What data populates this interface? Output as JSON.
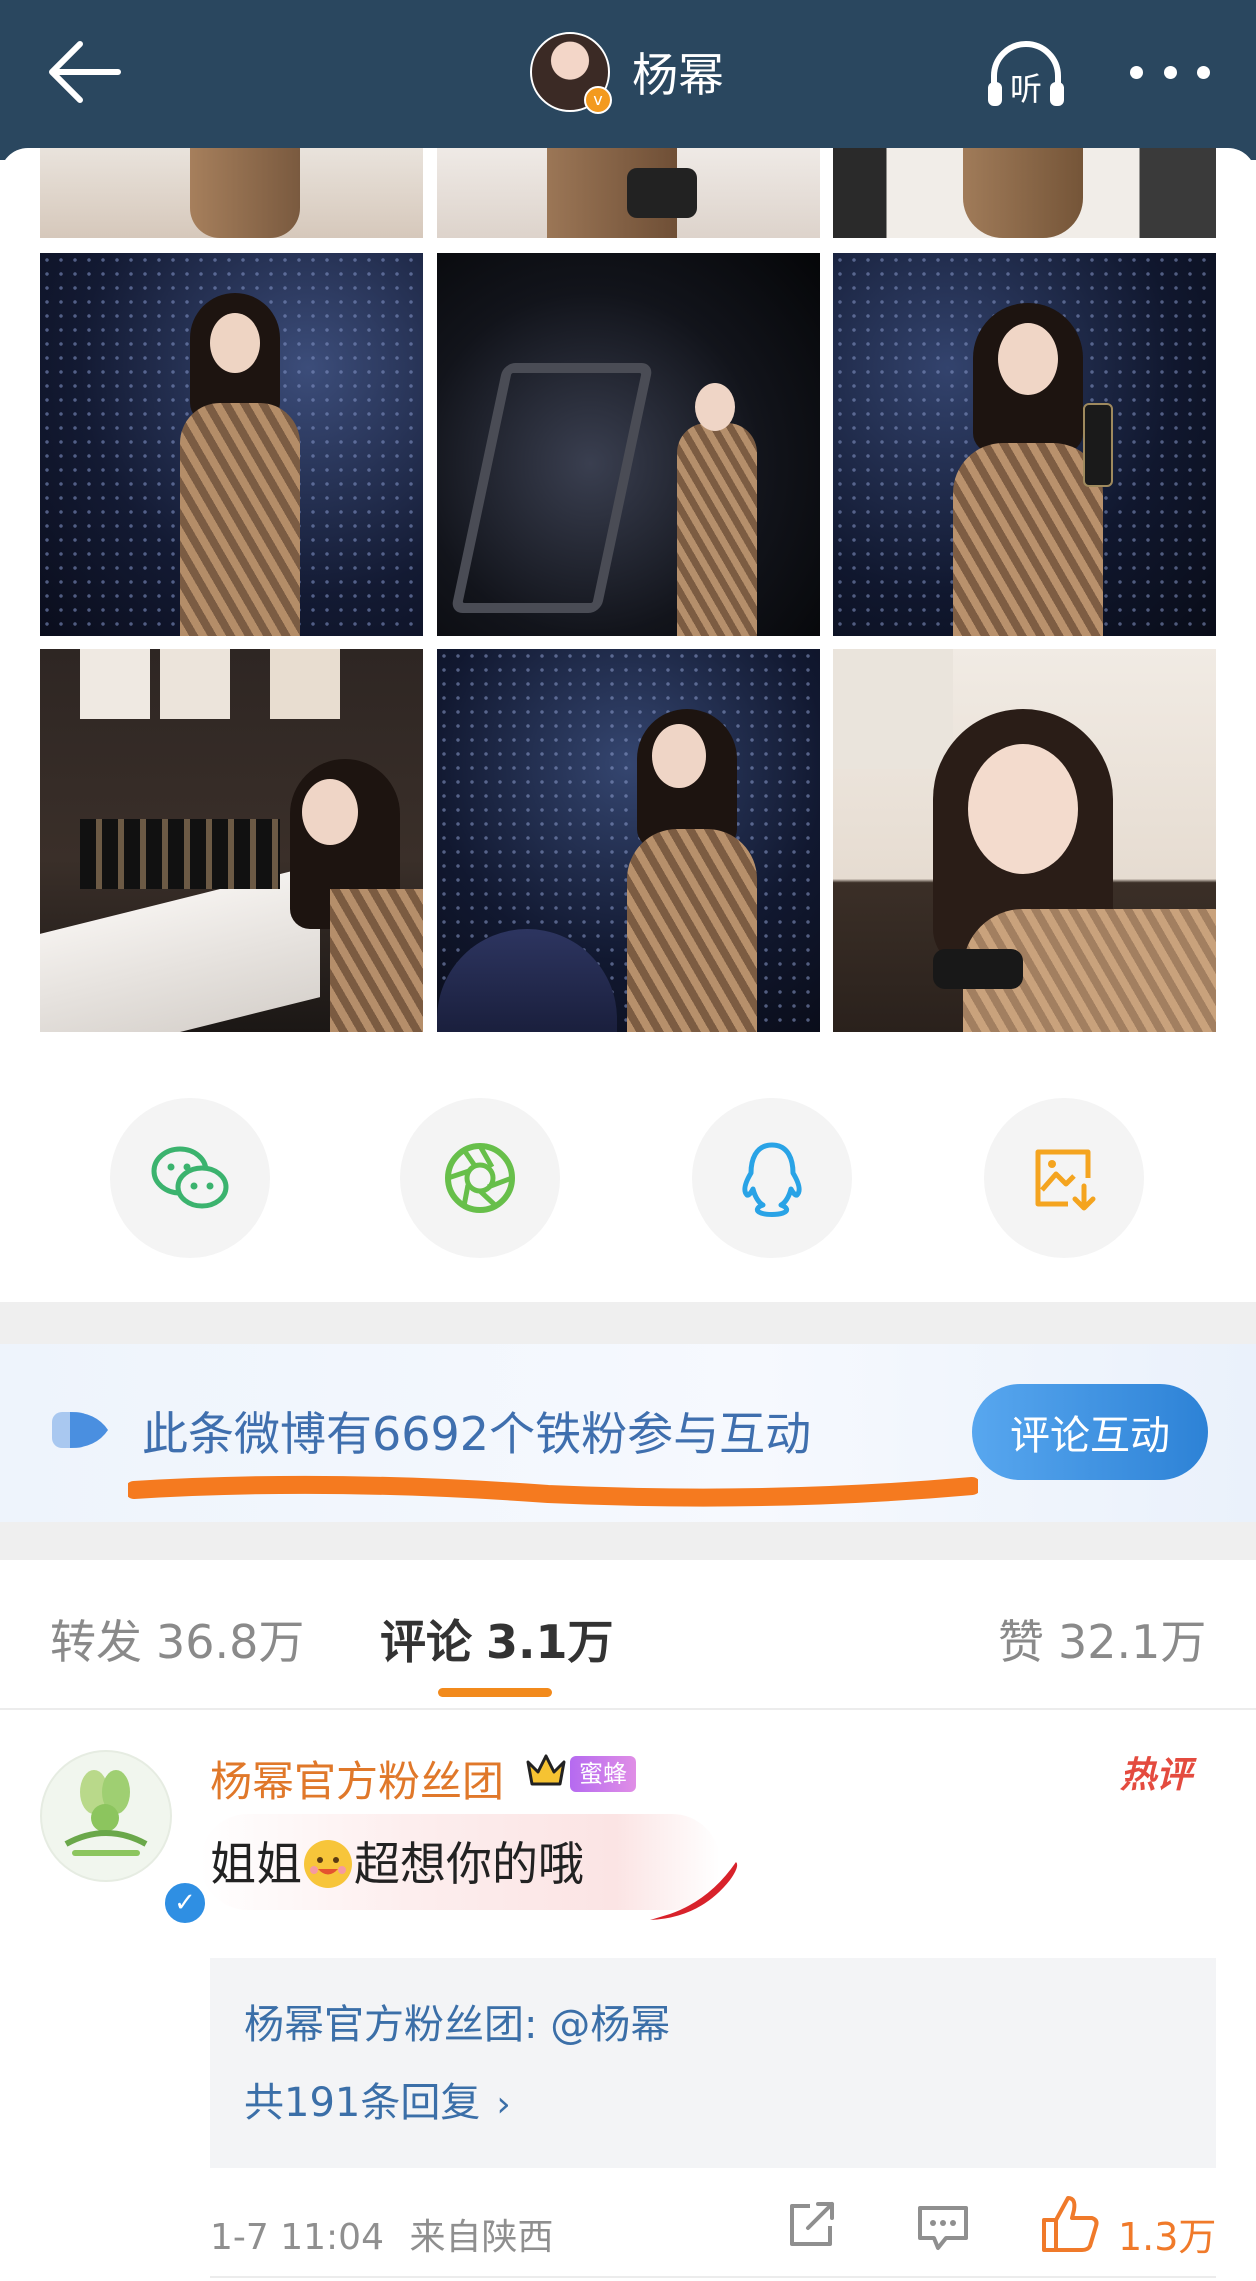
{
  "header": {
    "title": "杨幂",
    "back_icon": "arrow-left-icon",
    "listen_label": "听",
    "more_icon": "more-dots-icon",
    "verified_mark": "v",
    "bg_color": "#2a475f"
  },
  "photos": [
    {
      "name": "photo-1-1",
      "tone": "light"
    },
    {
      "name": "photo-1-2",
      "tone": "light"
    },
    {
      "name": "photo-1-3",
      "tone": "light"
    },
    {
      "name": "photo-2-1",
      "tone": "dark"
    },
    {
      "name": "photo-2-2",
      "tone": "dark"
    },
    {
      "name": "photo-2-3",
      "tone": "dark"
    },
    {
      "name": "photo-3-1",
      "tone": "dark"
    },
    {
      "name": "photo-3-2",
      "tone": "dark"
    },
    {
      "name": "photo-3-3",
      "tone": "light"
    }
  ],
  "share": [
    {
      "icon": "wechat-icon",
      "color": "#3bb36e"
    },
    {
      "icon": "moments-icon",
      "color": "#67bf4a"
    },
    {
      "icon": "qq-icon",
      "color": "#29a3e6"
    },
    {
      "icon": "save-image-icon",
      "color": "#f4a41f"
    }
  ],
  "fans_banner": {
    "text": "此条微博有6692个铁粉参与互动",
    "button": "评论互动",
    "underline_color": "#f57a1f"
  },
  "tabs": {
    "repost_label": "转发",
    "repost_count": "36.8万",
    "comment_label": "评论",
    "comment_count": "3.1万",
    "like_label": "赞",
    "like_count": "32.1万",
    "accent": "#f28a1c"
  },
  "comment": {
    "author": "杨幂官方粉丝团",
    "badge": "蜜蜂",
    "hot_tag": "热评",
    "text_before": "姐姐",
    "text_after": "超想你的哦",
    "emoji_icon": "happy-face-emoji-icon",
    "reply_preview": "杨幂官方粉丝团: @杨幂",
    "reply_count": "共191条回复",
    "reply_chevron": "›",
    "time": "1-7 11:04",
    "location": "来自陕西",
    "like_count": "1.3万",
    "name_color": "#e0782a",
    "link_color": "#3b6fa8"
  }
}
